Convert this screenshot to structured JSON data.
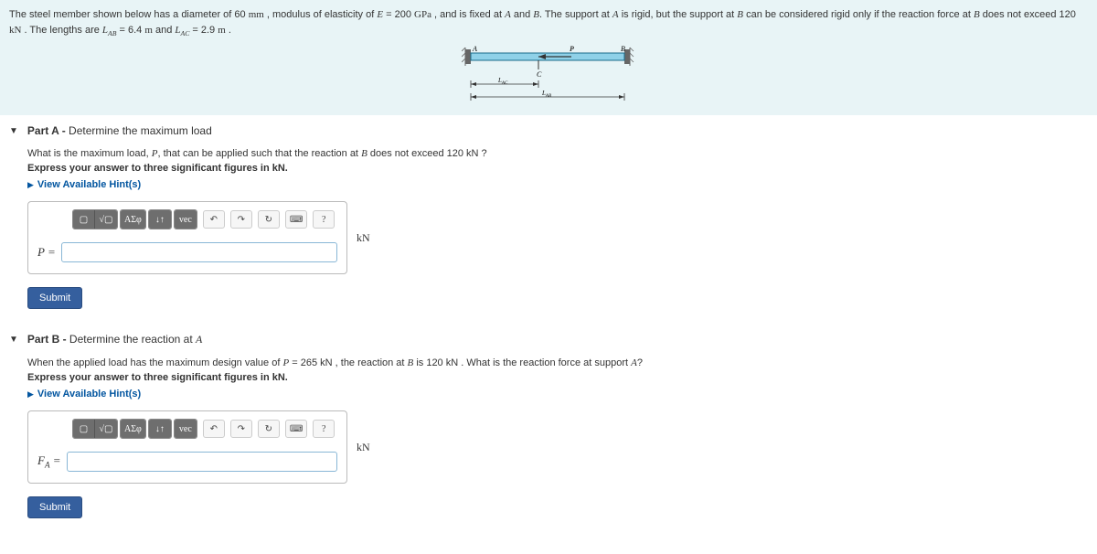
{
  "problem": {
    "text_1": "The steel member shown below has a diameter of 60 ",
    "unit_mm": "mm",
    "text_2": " , modulus of elasticity of ",
    "var_E": "E",
    "text_3": " = 200 ",
    "unit_GPa": "GPa",
    "text_4": " , and is fixed at ",
    "var_A1": "A",
    "text_5": " and ",
    "var_B1": "B",
    "text_6": ". The support at ",
    "var_A2": "A",
    "text_7": " is rigid, but the support at ",
    "var_B2": "B",
    "text_8": " can be considered rigid only if the reaction force at ",
    "var_B3": "B",
    "text_9": " does not exceed 120 ",
    "unit_kN1": "kN",
    "text_10": " . The lengths are ",
    "var_LAB": "L",
    "sub_AB": "AB",
    "text_11": " = 6.4 ",
    "unit_m1": "m",
    "text_12": " and ",
    "var_LAC": "L",
    "sub_AC": "AC",
    "text_13": " = 2.9 ",
    "unit_m2": "m",
    "text_14": " ."
  },
  "figure": {
    "label_A": "A",
    "label_B": "B",
    "label_C": "C",
    "label_P": "P",
    "label_LAC": "L",
    "sub_LAC": "AC",
    "label_LAB": "L",
    "sub_LAB": "AB"
  },
  "toolbar": {
    "templates_icon": "▢",
    "sqrt_icon": "√▢",
    "greek": "ΑΣφ",
    "scripts": "↓↑",
    "vec": "vec",
    "undo": "↶",
    "redo": "↷",
    "reset": "↻",
    "keyboard": "⌨",
    "help": "?"
  },
  "partA": {
    "caret": "▼",
    "title_bold": "Part A - ",
    "title_rest": "Determine the maximum load",
    "q1a": "What is the maximum load, ",
    "q1_var": "P",
    "q1b": ", that can be applied such that the reaction at ",
    "q1_varB": "B",
    "q1c": " does not exceed 120 ",
    "q1_unit": "kN",
    "q1d": " ?",
    "q2": "Express your answer to three significant figures in kN.",
    "hints_caret": "▶",
    "hints": "View Available Hint(s)",
    "answer_var": "P",
    "answer_eq": " = ",
    "answer_value": "",
    "answer_unit": "kN",
    "submit": "Submit"
  },
  "partB": {
    "caret": "▼",
    "title_bold": "Part B - ",
    "title_rest": "Determine the reaction at ",
    "title_var": "A",
    "q1a": "When the applied load has the maximum design value of ",
    "q1_varP": "P",
    "q1b": " = 265 ",
    "q1_unit1": "kN",
    "q1c": " , the reaction at ",
    "q1_varB": "B",
    "q1d": " is 120 ",
    "q1_unit2": "kN",
    "q1e": " . What is the reaction force at support ",
    "q1_varA": "A",
    "q1f": "?",
    "q2": "Express your answer to three significant figures in kN.",
    "hints_caret": "▶",
    "hints": "View Available Hint(s)",
    "answer_var": "F",
    "answer_sub": "A",
    "answer_eq": " = ",
    "answer_value": "",
    "answer_unit": "kN",
    "submit": "Submit"
  }
}
